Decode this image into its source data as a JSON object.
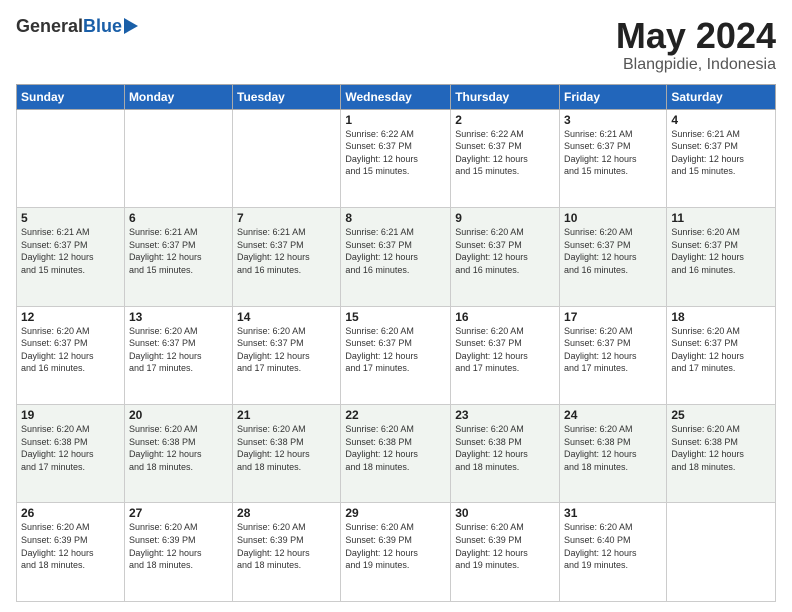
{
  "header": {
    "logo_general": "General",
    "logo_blue": "Blue",
    "title": "May 2024",
    "location": "Blangpidie, Indonesia"
  },
  "days_of_week": [
    "Sunday",
    "Monday",
    "Tuesday",
    "Wednesday",
    "Thursday",
    "Friday",
    "Saturday"
  ],
  "weeks": [
    [
      {
        "num": "",
        "info": ""
      },
      {
        "num": "",
        "info": ""
      },
      {
        "num": "",
        "info": ""
      },
      {
        "num": "1",
        "info": "Sunrise: 6:22 AM\nSunset: 6:37 PM\nDaylight: 12 hours\nand 15 minutes."
      },
      {
        "num": "2",
        "info": "Sunrise: 6:22 AM\nSunset: 6:37 PM\nDaylight: 12 hours\nand 15 minutes."
      },
      {
        "num": "3",
        "info": "Sunrise: 6:21 AM\nSunset: 6:37 PM\nDaylight: 12 hours\nand 15 minutes."
      },
      {
        "num": "4",
        "info": "Sunrise: 6:21 AM\nSunset: 6:37 PM\nDaylight: 12 hours\nand 15 minutes."
      }
    ],
    [
      {
        "num": "5",
        "info": "Sunrise: 6:21 AM\nSunset: 6:37 PM\nDaylight: 12 hours\nand 15 minutes."
      },
      {
        "num": "6",
        "info": "Sunrise: 6:21 AM\nSunset: 6:37 PM\nDaylight: 12 hours\nand 15 minutes."
      },
      {
        "num": "7",
        "info": "Sunrise: 6:21 AM\nSunset: 6:37 PM\nDaylight: 12 hours\nand 16 minutes."
      },
      {
        "num": "8",
        "info": "Sunrise: 6:21 AM\nSunset: 6:37 PM\nDaylight: 12 hours\nand 16 minutes."
      },
      {
        "num": "9",
        "info": "Sunrise: 6:20 AM\nSunset: 6:37 PM\nDaylight: 12 hours\nand 16 minutes."
      },
      {
        "num": "10",
        "info": "Sunrise: 6:20 AM\nSunset: 6:37 PM\nDaylight: 12 hours\nand 16 minutes."
      },
      {
        "num": "11",
        "info": "Sunrise: 6:20 AM\nSunset: 6:37 PM\nDaylight: 12 hours\nand 16 minutes."
      }
    ],
    [
      {
        "num": "12",
        "info": "Sunrise: 6:20 AM\nSunset: 6:37 PM\nDaylight: 12 hours\nand 16 minutes."
      },
      {
        "num": "13",
        "info": "Sunrise: 6:20 AM\nSunset: 6:37 PM\nDaylight: 12 hours\nand 17 minutes."
      },
      {
        "num": "14",
        "info": "Sunrise: 6:20 AM\nSunset: 6:37 PM\nDaylight: 12 hours\nand 17 minutes."
      },
      {
        "num": "15",
        "info": "Sunrise: 6:20 AM\nSunset: 6:37 PM\nDaylight: 12 hours\nand 17 minutes."
      },
      {
        "num": "16",
        "info": "Sunrise: 6:20 AM\nSunset: 6:37 PM\nDaylight: 12 hours\nand 17 minutes."
      },
      {
        "num": "17",
        "info": "Sunrise: 6:20 AM\nSunset: 6:37 PM\nDaylight: 12 hours\nand 17 minutes."
      },
      {
        "num": "18",
        "info": "Sunrise: 6:20 AM\nSunset: 6:37 PM\nDaylight: 12 hours\nand 17 minutes."
      }
    ],
    [
      {
        "num": "19",
        "info": "Sunrise: 6:20 AM\nSunset: 6:38 PM\nDaylight: 12 hours\nand 17 minutes."
      },
      {
        "num": "20",
        "info": "Sunrise: 6:20 AM\nSunset: 6:38 PM\nDaylight: 12 hours\nand 18 minutes."
      },
      {
        "num": "21",
        "info": "Sunrise: 6:20 AM\nSunset: 6:38 PM\nDaylight: 12 hours\nand 18 minutes."
      },
      {
        "num": "22",
        "info": "Sunrise: 6:20 AM\nSunset: 6:38 PM\nDaylight: 12 hours\nand 18 minutes."
      },
      {
        "num": "23",
        "info": "Sunrise: 6:20 AM\nSunset: 6:38 PM\nDaylight: 12 hours\nand 18 minutes."
      },
      {
        "num": "24",
        "info": "Sunrise: 6:20 AM\nSunset: 6:38 PM\nDaylight: 12 hours\nand 18 minutes."
      },
      {
        "num": "25",
        "info": "Sunrise: 6:20 AM\nSunset: 6:38 PM\nDaylight: 12 hours\nand 18 minutes."
      }
    ],
    [
      {
        "num": "26",
        "info": "Sunrise: 6:20 AM\nSunset: 6:39 PM\nDaylight: 12 hours\nand 18 minutes."
      },
      {
        "num": "27",
        "info": "Sunrise: 6:20 AM\nSunset: 6:39 PM\nDaylight: 12 hours\nand 18 minutes."
      },
      {
        "num": "28",
        "info": "Sunrise: 6:20 AM\nSunset: 6:39 PM\nDaylight: 12 hours\nand 18 minutes."
      },
      {
        "num": "29",
        "info": "Sunrise: 6:20 AM\nSunset: 6:39 PM\nDaylight: 12 hours\nand 19 minutes."
      },
      {
        "num": "30",
        "info": "Sunrise: 6:20 AM\nSunset: 6:39 PM\nDaylight: 12 hours\nand 19 minutes."
      },
      {
        "num": "31",
        "info": "Sunrise: 6:20 AM\nSunset: 6:40 PM\nDaylight: 12 hours\nand 19 minutes."
      },
      {
        "num": "",
        "info": ""
      }
    ]
  ]
}
